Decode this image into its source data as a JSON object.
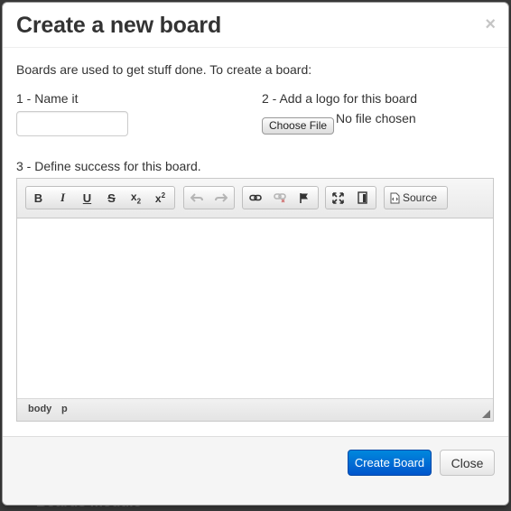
{
  "backdrop_text": "Boards module",
  "modal": {
    "title": "Create a new board",
    "close_glyph": "×",
    "intro": "Boards are used to get stuff done. To create a board:",
    "step1_label": "1 - Name it",
    "name_value": "",
    "step2_label": "2 - Add a logo for this board",
    "file_button_label": "Choose File",
    "file_status": "No file chosen",
    "step3_label": "3 - Define success for this board.",
    "editor": {
      "source_label": "Source",
      "path": [
        "body",
        "p"
      ],
      "toolbar_icons": [
        "bold-icon",
        "italic-icon",
        "underline-icon",
        "strikethrough-icon",
        "subscript-icon",
        "superscript-icon",
        "undo-icon",
        "redo-icon",
        "link-icon",
        "unlink-icon",
        "anchor-flag-icon",
        "maximize-icon",
        "show-blocks-icon",
        "source-icon"
      ]
    },
    "buttons": {
      "create": "Create Board",
      "close": "Close"
    }
  }
}
